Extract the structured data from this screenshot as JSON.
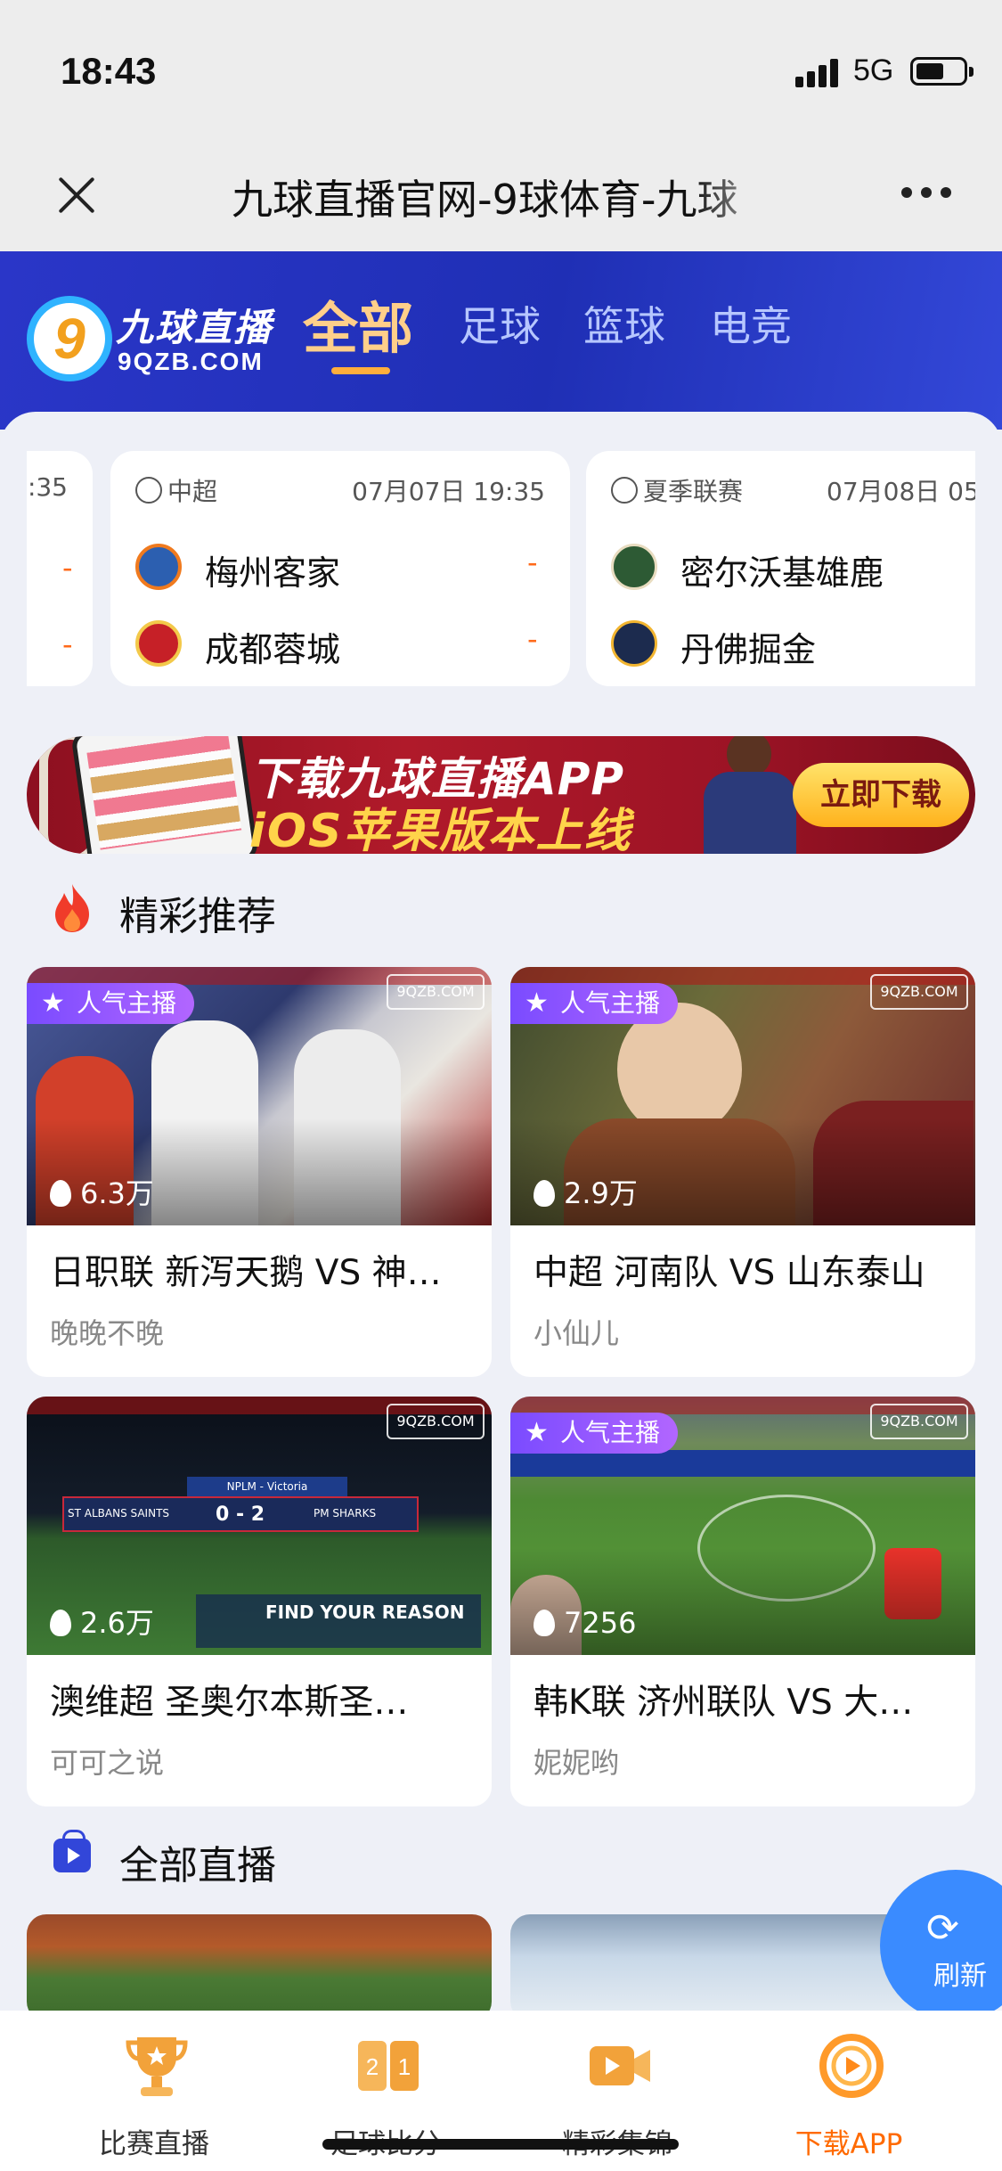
{
  "status_bar": {
    "time": "18:43",
    "network": "5G"
  },
  "browser": {
    "title": "九球直播官网-9球体育-九球"
  },
  "site": {
    "logo_name": "九球直播",
    "logo_domain": "9QZB.COM",
    "tabs": [
      "全部",
      "足球",
      "篮球",
      "电竞"
    ],
    "active_tab": "全部"
  },
  "matches": [
    {
      "league": "",
      "date": ":35",
      "home": {
        "name": "",
        "score": "-"
      },
      "away": {
        "name": "",
        "score": "-"
      }
    },
    {
      "league": "中超",
      "league_icon": "soccer-ball-icon",
      "date": "07月07日 19:35",
      "home": {
        "name": "梅州客家",
        "score": "-",
        "badge_color": "#2c5fb0"
      },
      "away": {
        "name": "成都蓉城",
        "score": "-",
        "badge_color": "#c62027"
      }
    },
    {
      "league": "夏季联赛",
      "league_icon": "basketball-icon",
      "date": "07月08日 05",
      "home": {
        "name": "密尔沃基雄鹿",
        "score": "",
        "badge_color": "#2d5a34"
      },
      "away": {
        "name": "丹佛掘金",
        "score": "",
        "badge_color": "#1c2b4e"
      }
    }
  ],
  "banner": {
    "line1": "下载九球直播APP",
    "line2": "iOS苹果版本上线",
    "button": "立即下载"
  },
  "sections": {
    "recommend": "精彩推荐",
    "all_live": "全部直播"
  },
  "featured": [
    {
      "title": "日职联 新泻天鹅 VS 神…",
      "anchor": "晚晚不晚",
      "heat": "6.3万",
      "tag": "人气主播",
      "thumb": "soccer-players"
    },
    {
      "title": "中超 河南队 VS 山东泰山",
      "anchor": "小仙儿",
      "heat": "2.9万",
      "tag": "人气主播",
      "thumb": "drama-scene"
    },
    {
      "title": "澳维超 圣奥尔本斯圣…",
      "anchor": "可可之说",
      "heat": "2.6万",
      "tag": "",
      "thumb": "night-stadium",
      "scoreboard": {
        "league": "NPLM - Victoria",
        "home": "ST ALBANS SAINTS",
        "away": "PM SHARKS",
        "score": "0 - 2",
        "caption": "FIND YOUR REASON"
      }
    },
    {
      "title": "韩K联 济州联队 VS 大…",
      "anchor": "妮妮哟",
      "heat": "7256",
      "tag": "人气主播",
      "thumb": "pitch-aerial"
    }
  ],
  "refresh_label": "刷新",
  "bottom_nav": [
    {
      "label": "比赛直播",
      "icon": "trophy-icon"
    },
    {
      "label": "足球比分",
      "icon": "scoreboard-icon"
    },
    {
      "label": "精彩集锦",
      "icon": "video-camera-icon"
    },
    {
      "label": "下载APP",
      "icon": "download-play-icon",
      "active": true
    }
  ],
  "colors": {
    "brand_blue": "#2a36c8",
    "accent_orange": "#ff6a00",
    "tag_purple": "#7a4bff"
  }
}
